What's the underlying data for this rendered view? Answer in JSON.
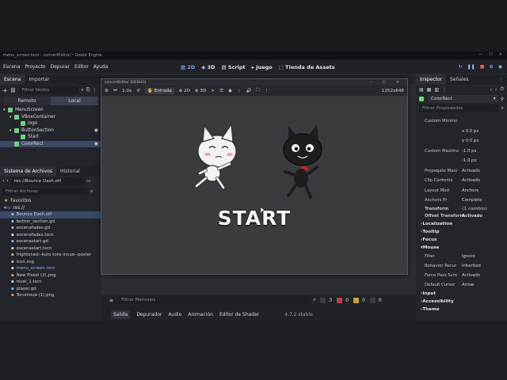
{
  "window_title": "menu_screen.tscn - concertEditor/ - Godot Engine",
  "menu": [
    "Escena",
    "Proyecto",
    "Depurar",
    "Editor",
    "Ayuda"
  ],
  "workspaces": [
    {
      "label": "2D",
      "active": true
    },
    {
      "label": "3D",
      "active": false
    },
    {
      "label": "Script",
      "active": false
    },
    {
      "label": "Juego",
      "active": false
    },
    {
      "label": "Tienda de Assets",
      "active": false
    }
  ],
  "scene_dock": {
    "tabs": [
      "Escena",
      "Importar"
    ],
    "filter_placeholder": "Filtrar Nodos",
    "remote_label": "Remoto",
    "local_label": "Local",
    "nodes": [
      {
        "label": "MenuScreen",
        "indent": 0,
        "color": "#6fd37e"
      },
      {
        "label": "VBoxContainer",
        "indent": 1,
        "color": "#6fd37e"
      },
      {
        "label": "logo",
        "indent": 2,
        "color": "#6fd37e"
      },
      {
        "label": "ButtonSection",
        "indent": 1,
        "color": "#6fd37e"
      },
      {
        "label": "Start",
        "indent": 2,
        "color": "#6fd37e"
      },
      {
        "label": "ColorRect",
        "indent": 1,
        "color": "#6fd37e",
        "selected": true
      }
    ]
  },
  "filesystem": {
    "tabs": [
      "Sistema de Archivos",
      "Historial"
    ],
    "path": "res://Bounce Dash.otf",
    "filter_placeholder": "Filtrar Archivos",
    "favorites": "Favoritos",
    "root": "res://",
    "files": [
      {
        "name": "Bounce Dash.otf",
        "selected": true
      },
      {
        "name": "button_section.gd"
      },
      {
        "name": "escenafades.gd"
      },
      {
        "name": "escenafades.tscn"
      },
      {
        "name": "escenastart.gd"
      },
      {
        "name": "escenastart.tscn"
      },
      {
        "name": "frightened--kuro-toro-inoue--poster"
      },
      {
        "name": "icon.svg"
      },
      {
        "name": "menu_screen.tscn"
      },
      {
        "name": "New Piskel (2).png"
      },
      {
        "name": "nivel_1.tscn"
      },
      {
        "name": "player.gd"
      },
      {
        "name": "ToruInoue (1).png"
      }
    ]
  },
  "game_window": {
    "title": "concertEditor (DEBUG)",
    "toolbar": {
      "zoom": "1.0x",
      "input_label": "Entrada",
      "mode_2d": "2D",
      "mode_3d": "3D",
      "resolution": "1152x648"
    },
    "start_text": "START"
  },
  "inspector": {
    "tabs": [
      "Inspector",
      "Señales"
    ],
    "node": "ColorRect",
    "filter_placeholder": "Filtrar Propiedades",
    "rows": [
      {
        "label": "Custom Minimo",
        "value": ""
      },
      {
        "label": "",
        "value": "x 0.0 px"
      },
      {
        "label": "",
        "value": "y 0.0 px"
      },
      {
        "label": "Custom Maximu",
        "value": "-1.0 px"
      },
      {
        "label": "",
        "value": "-1.0 px"
      },
      {
        "label": "Propagate Maxi",
        "value": "Activado"
      },
      {
        "label": "Clip Contents",
        "value": "Activado"
      },
      {
        "label": "Layout Mod",
        "value": "Anchors"
      },
      {
        "label": "Anchors Pr",
        "value": "Completo"
      },
      {
        "label": "Transform",
        "value": "(1 cambio)"
      },
      {
        "label": "Offset Transform",
        "value": "Activado"
      }
    ],
    "sections": [
      "Localization",
      "Tooltip",
      "Focus",
      "Mouse"
    ],
    "mouse_rows": [
      {
        "label": "Filter",
        "value": "Ignore"
      },
      {
        "label": "Behavior Recur",
        "value": "Inherited"
      },
      {
        "label": "Force Pass Scro",
        "value": "Activado"
      },
      {
        "label": "Default Cursor",
        "value": "Arrow"
      }
    ],
    "tail_sections": [
      "Input",
      "Accessibility",
      "Theme"
    ]
  },
  "bottom": {
    "filter_placeholder": "Filtrar Mensajes",
    "tabs": [
      "Salida",
      "Depurador",
      "Audio",
      "Animación",
      "Editor de Shader"
    ],
    "version": "4.7.2.stable",
    "counts": [
      "3",
      "0",
      "0",
      "0"
    ]
  },
  "colors": {
    "accent": "#6da3ff",
    "green": "#6fd37e",
    "selected": "#3a4a66"
  }
}
